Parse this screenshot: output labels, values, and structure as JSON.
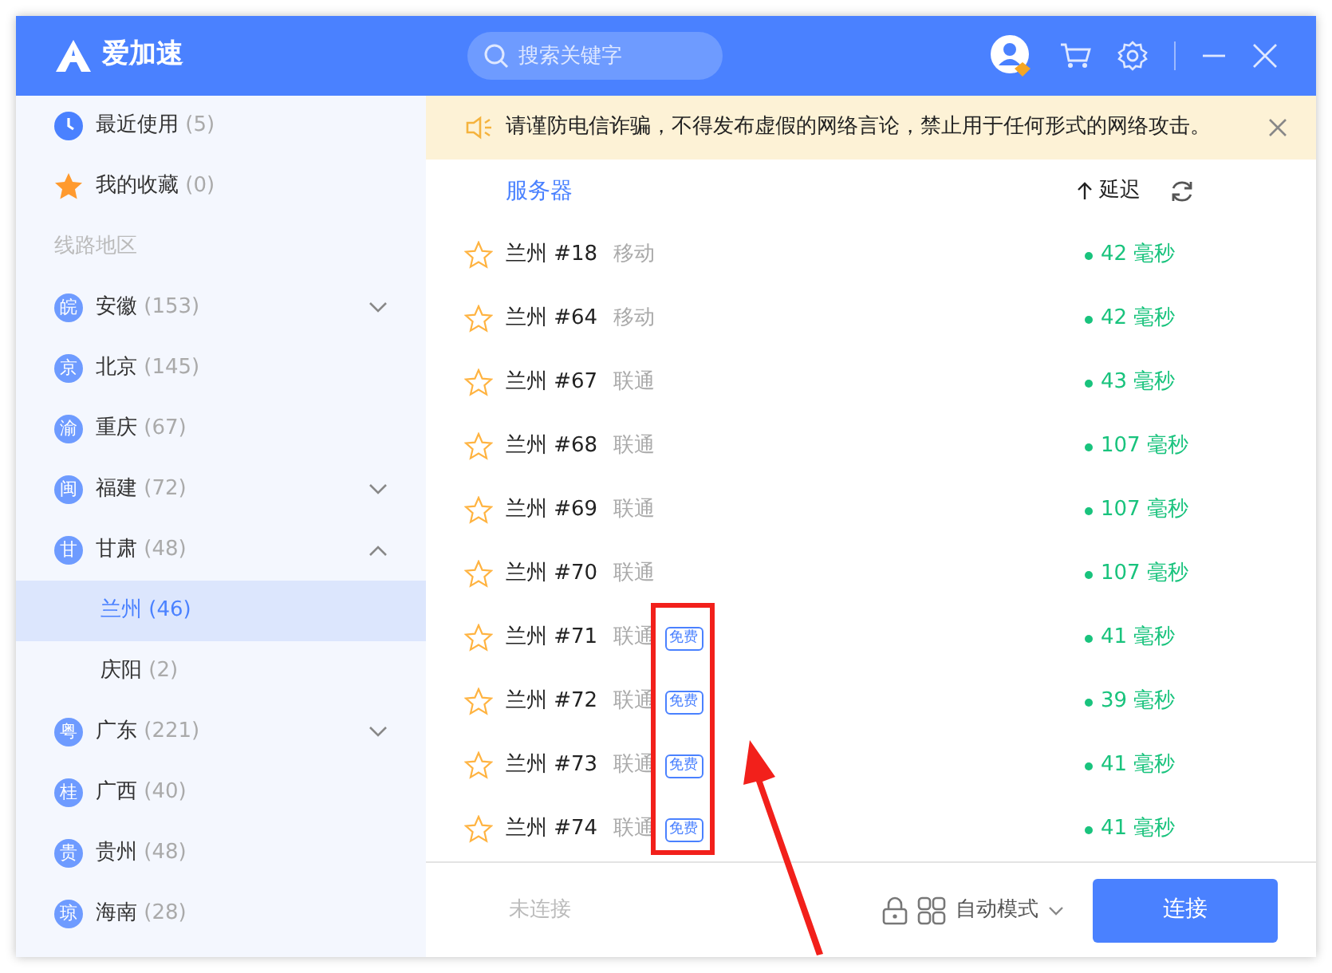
{
  "app": {
    "logo_text": "爱加速",
    "search_placeholder": "搜索关键字"
  },
  "notice": {
    "text": "请谨防电信诈骗，不得发布虚假的网络言论，禁止用于任何形式的网络攻击。"
  },
  "sidebar": {
    "quick": [
      {
        "kind": "clock",
        "label": "最近使用",
        "count": "(5)"
      },
      {
        "kind": "star",
        "label": "我的收藏",
        "count": "(0)"
      }
    ],
    "section_title": "线路地区",
    "regions": [
      {
        "kind": "group",
        "badge": "皖",
        "label": "安徽",
        "count": "(153)",
        "expanded": false
      },
      {
        "kind": "leaf",
        "badge": "京",
        "label": "北京",
        "count": "(145)"
      },
      {
        "kind": "leaf",
        "badge": "渝",
        "label": "重庆",
        "count": "(67)"
      },
      {
        "kind": "group",
        "badge": "闽",
        "label": "福建",
        "count": "(72)",
        "expanded": false
      },
      {
        "kind": "group",
        "badge": "甘",
        "label": "甘肃",
        "count": "(48)",
        "expanded": true,
        "children": [
          {
            "label": "兰州",
            "count": "(46)",
            "selected": true
          },
          {
            "label": "庆阳",
            "count": "(2)",
            "selected": false
          }
        ]
      },
      {
        "kind": "group",
        "badge": "粤",
        "label": "广东",
        "count": "(221)",
        "expanded": false
      },
      {
        "kind": "leaf",
        "badge": "桂",
        "label": "广西",
        "count": "(40)"
      },
      {
        "kind": "leaf",
        "badge": "贵",
        "label": "贵州",
        "count": "(48)"
      },
      {
        "kind": "leaf",
        "badge": "琼",
        "label": "海南",
        "count": "(28)"
      }
    ]
  },
  "list_header": {
    "server": "服务器",
    "latency": "延迟"
  },
  "servers": [
    {
      "name": "兰州 #18",
      "isp": "移动",
      "favorite": false,
      "latency": "42 毫秒"
    },
    {
      "name": "兰州 #64",
      "isp": "移动",
      "favorite": false,
      "latency": "42 毫秒"
    },
    {
      "name": "兰州 #67",
      "isp": "联通",
      "favorite": false,
      "latency": "43 毫秒"
    },
    {
      "name": "兰州 #68",
      "isp": "联通",
      "favorite": false,
      "latency": "107 毫秒"
    },
    {
      "name": "兰州 #69",
      "isp": "联通",
      "favorite": false,
      "latency": "107 毫秒"
    },
    {
      "name": "兰州 #70",
      "isp": "联通",
      "favorite": false,
      "latency": "107 毫秒"
    },
    {
      "name": "兰州 #71",
      "isp": "联通",
      "badge": "免费",
      "favorite": false,
      "latency": "41 毫秒"
    },
    {
      "name": "兰州 #72",
      "isp": "联通",
      "badge": "免费",
      "favorite": false,
      "latency": "39 毫秒"
    },
    {
      "name": "兰州 #73",
      "isp": "联通",
      "badge": "免费",
      "favorite": false,
      "latency": "41 毫秒"
    },
    {
      "name": "兰州 #74",
      "isp": "联通",
      "badge": "免费",
      "favorite": false,
      "latency": "41 毫秒"
    }
  ],
  "footer": {
    "status": "未连接",
    "mode": "自动模式",
    "connect_button": "连接"
  }
}
